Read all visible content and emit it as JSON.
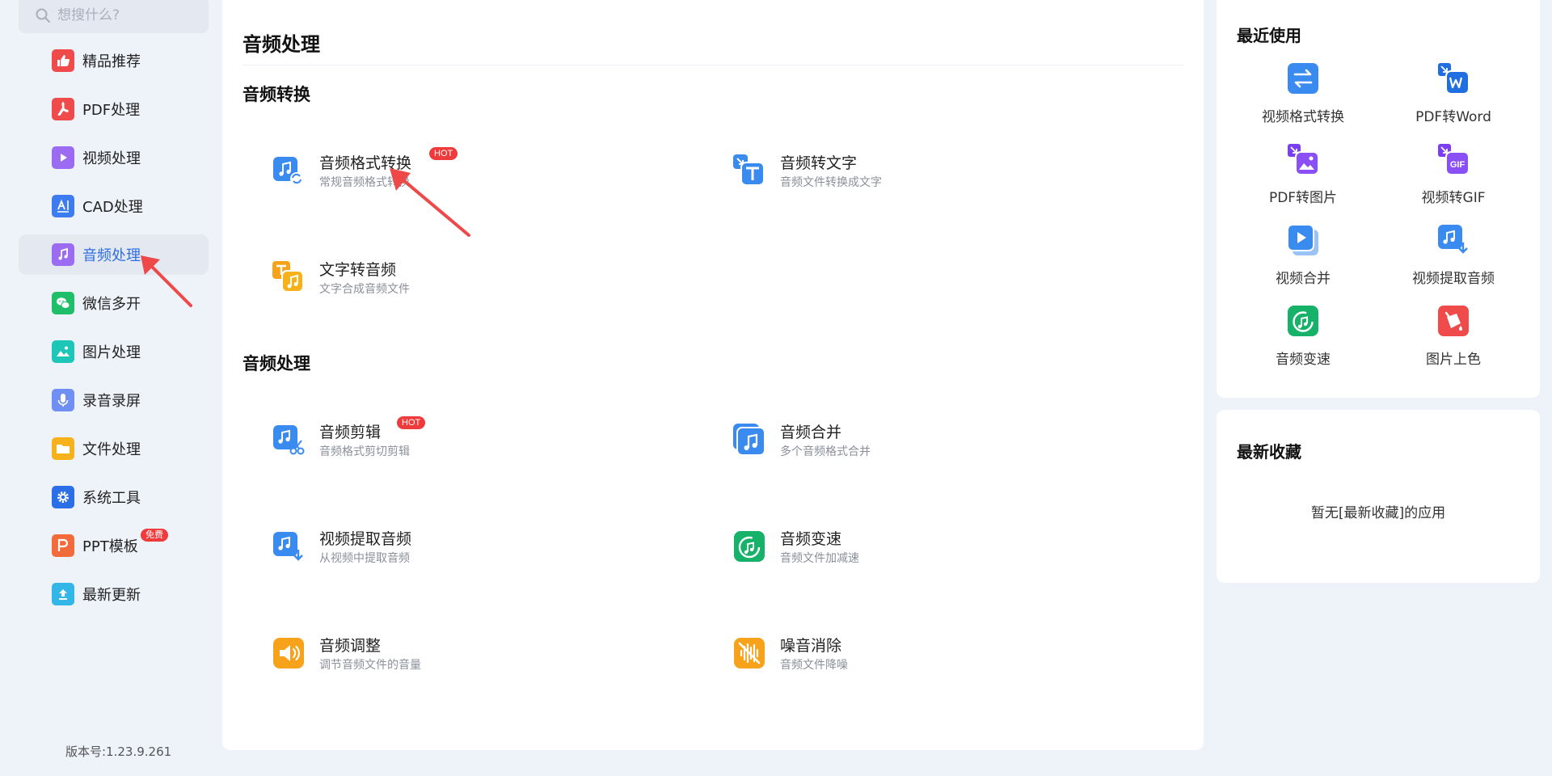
{
  "search": {
    "placeholder": "想搜什么?"
  },
  "sidebar": {
    "items": [
      {
        "label": "精品推荐",
        "icon": "thumbs-up-icon",
        "color": "#ef4b4b"
      },
      {
        "label": "PDF处理",
        "icon": "pdf-icon",
        "color": "#ef4b4b"
      },
      {
        "label": "视频处理",
        "icon": "video-play-icon",
        "color": "#9b6cf2"
      },
      {
        "label": "CAD处理",
        "icon": "cad-icon",
        "color": "#3d7bf0"
      },
      {
        "label": "音频处理",
        "icon": "music-note-icon",
        "color": "#9b6cf2",
        "active": true
      },
      {
        "label": "微信多开",
        "icon": "wechat-icon",
        "color": "#1fbf6a"
      },
      {
        "label": "图片处理",
        "icon": "image-icon",
        "color": "#1ec6b8"
      },
      {
        "label": "录音录屏",
        "icon": "microphone-icon",
        "color": "#6f8ff5"
      },
      {
        "label": "文件处理",
        "icon": "folder-icon",
        "color": "#f7b21b"
      },
      {
        "label": "系统工具",
        "icon": "gear-icon",
        "color": "#2a6ee8"
      },
      {
        "label": "PPT模板",
        "icon": "ppt-icon",
        "color": "#f26b3a",
        "badge": "免费"
      },
      {
        "label": "最新更新",
        "icon": "upload-icon",
        "color": "#32b7e8"
      }
    ]
  },
  "version": "版本号:1.23.9.261",
  "main": {
    "title": "音频处理",
    "sections": [
      {
        "title": "音频转换",
        "tools": [
          {
            "name": "音频格式转换",
            "desc": "常规音频格式转换",
            "hot": "HOT",
            "icon": "audio-convert-icon"
          },
          {
            "name": "音频转文字",
            "desc": "音频文件转换成文字",
            "icon": "audio-to-text-icon"
          },
          {
            "name": "文字转音频",
            "desc": "文字合成音频文件",
            "icon": "text-to-audio-icon"
          }
        ]
      },
      {
        "title": "音频处理",
        "tools": [
          {
            "name": "音频剪辑",
            "desc": "音频格式剪切剪辑",
            "hot": "HOT",
            "icon": "audio-cut-icon"
          },
          {
            "name": "音频合并",
            "desc": "多个音频格式合并",
            "icon": "audio-merge-icon"
          },
          {
            "name": "视频提取音频",
            "desc": "从视频中提取音频",
            "icon": "extract-audio-icon"
          },
          {
            "name": "音频变速",
            "desc": "音频文件加减速",
            "icon": "audio-speed-icon"
          },
          {
            "name": "音频调整",
            "desc": "调节音频文件的音量",
            "icon": "volume-icon"
          },
          {
            "name": "噪音消除",
            "desc": "音频文件降噪",
            "icon": "denoise-icon"
          }
        ]
      }
    ]
  },
  "recent": {
    "title": "最近使用",
    "items": [
      {
        "label": "视频格式转换",
        "icon": "swap-icon"
      },
      {
        "label": "PDF转Word",
        "icon": "pdf-to-word-icon"
      },
      {
        "label": "PDF转图片",
        "icon": "pdf-to-image-icon"
      },
      {
        "label": "视频转GIF",
        "icon": "video-to-gif-icon"
      },
      {
        "label": "视频合并",
        "icon": "video-merge-icon"
      },
      {
        "label": "视频提取音频",
        "icon": "extract-audio-icon"
      },
      {
        "label": "音频变速",
        "icon": "audio-speed-icon"
      },
      {
        "label": "图片上色",
        "icon": "colorize-icon"
      }
    ]
  },
  "favorites": {
    "title": "最新收藏",
    "empty_text": "暂无[最新收藏]的应用"
  },
  "colors": {
    "accent": "#2f6ee6",
    "hot_badge": "#ef3b3b",
    "annotation_arrow": "#ee4848"
  }
}
